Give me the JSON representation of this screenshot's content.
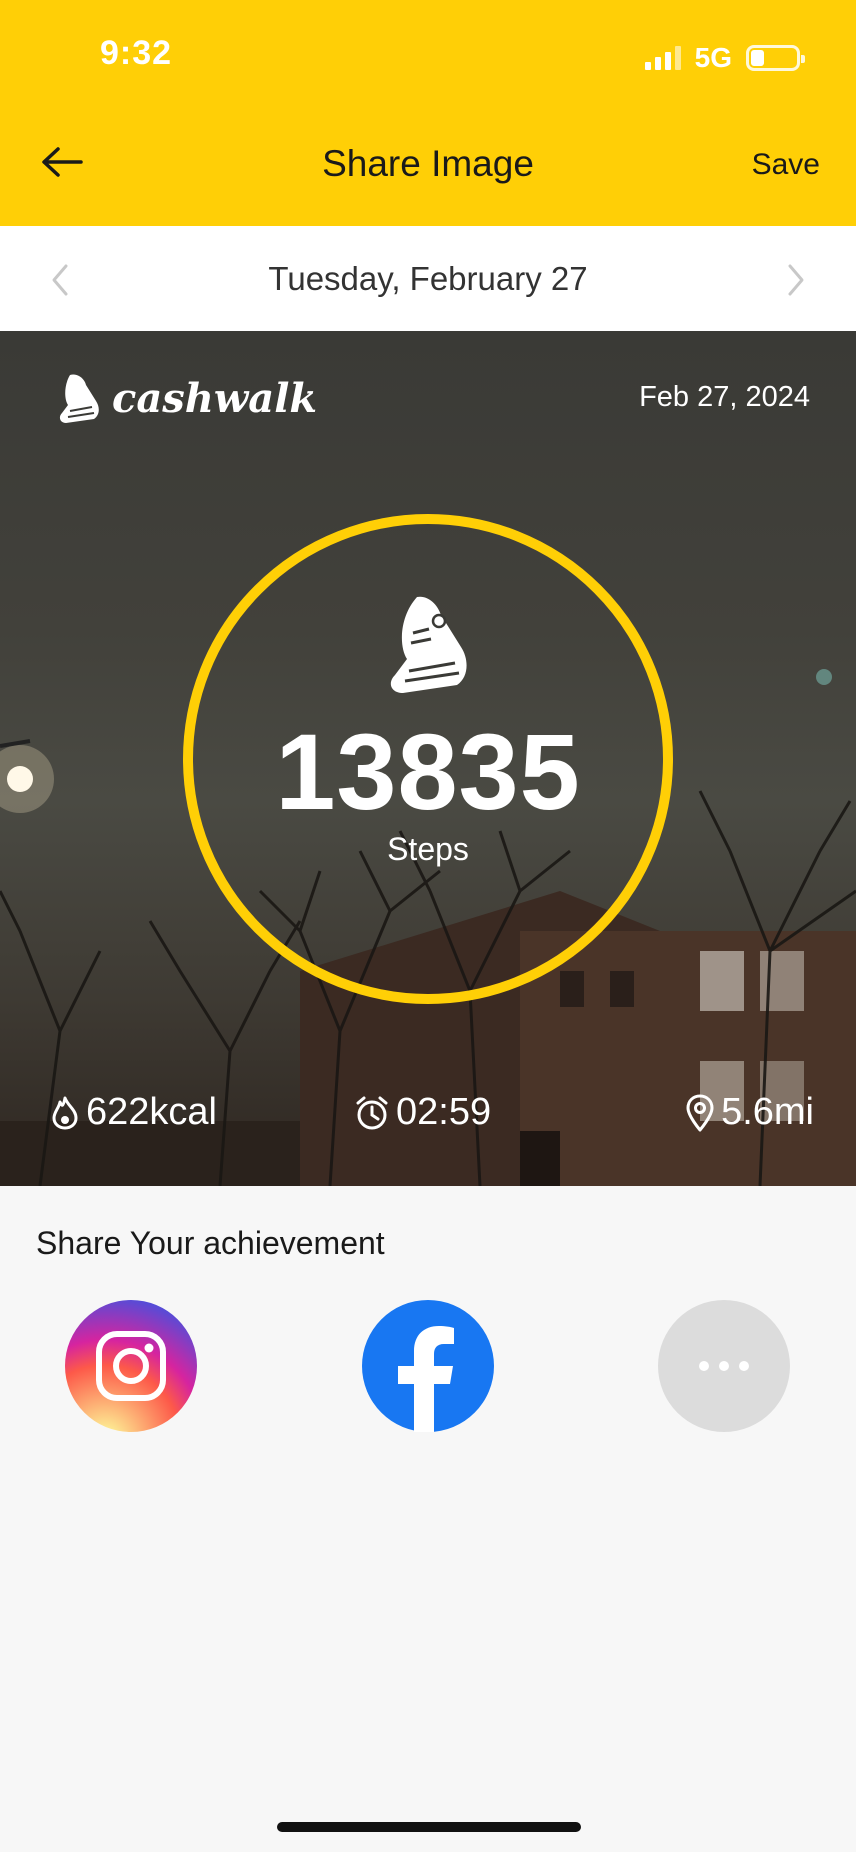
{
  "status_bar": {
    "time": "9:32",
    "network": "5G",
    "battery_level": 0.3
  },
  "header": {
    "title": "Share Image",
    "save_label": "Save",
    "back_icon": "arrow-left-icon"
  },
  "date_nav": {
    "label": "Tuesday, February 27",
    "prev_icon": "chevron-left-icon",
    "next_icon": "chevron-right-icon"
  },
  "card": {
    "brand": "cashwalk",
    "date": "Feb 27, 2024",
    "steps": "13835",
    "steps_label": "Steps",
    "calories": "622kcal",
    "duration": "02:59",
    "distance": "5.6mi",
    "ring_color": "#FFCF06"
  },
  "share": {
    "title": "Share Your achievement",
    "buttons": [
      "instagram-icon",
      "facebook-icon",
      "more-icon"
    ]
  },
  "colors": {
    "accent": "#FFCF06",
    "facebook": "#1877F2",
    "more": "#dcdcdc"
  }
}
